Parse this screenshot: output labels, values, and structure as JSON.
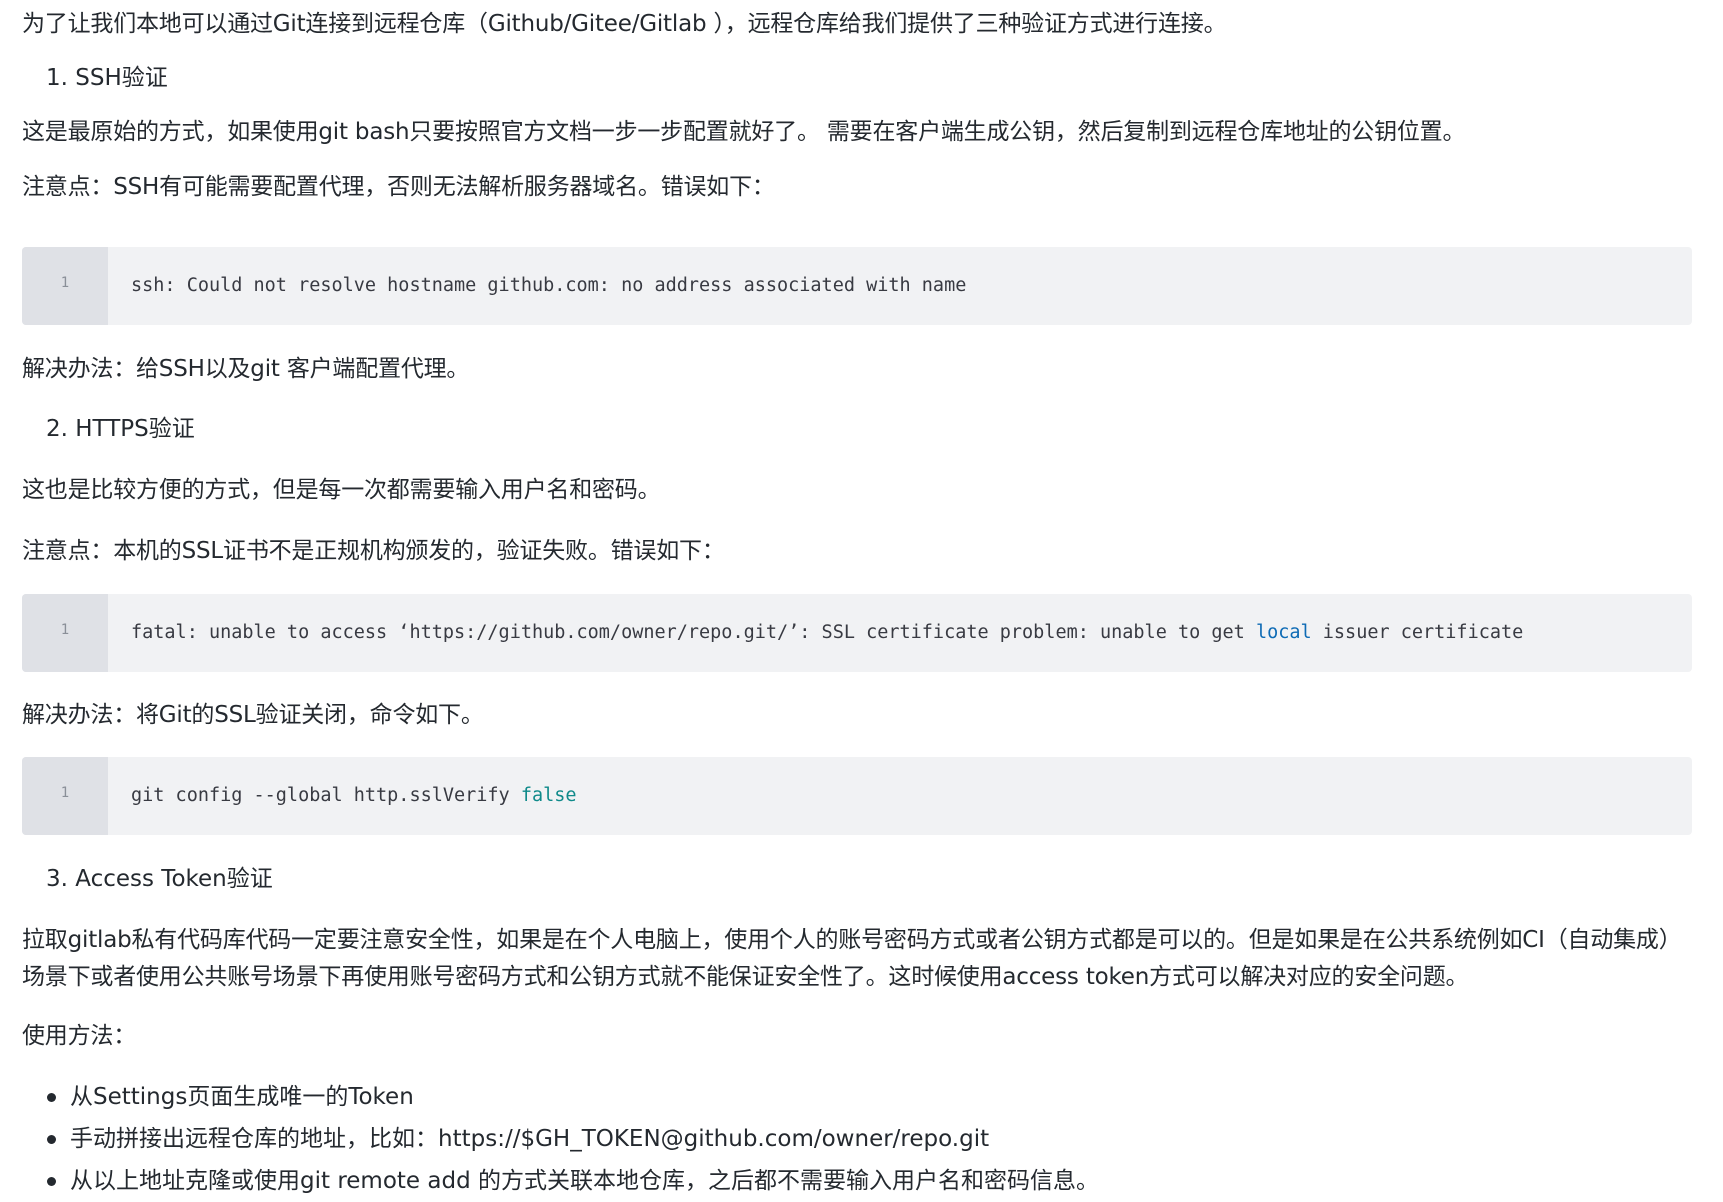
{
  "intro": "为了让我们本地可以通过Git连接到远程仓库（Github/Gitee/Gitlab ），远程仓库给我们提供了三种验证方式进行连接。",
  "sections": {
    "ssh": {
      "heading": "1. SSH验证",
      "desc": "这是最原始的方式，如果使用git bash只要按照官方文档一步一步配置就好了。 需要在客户端生成公钥，然后复制到远程仓库地址的公钥位置。",
      "note": "注意点：SSH有可能需要配置代理，否则无法解析服务器域名。错误如下：",
      "code": {
        "line_no": "1",
        "text": "ssh: Could not resolve hostname github.com: no address associated with name"
      },
      "solution": "解决办法：给SSH以及git 客户端配置代理。"
    },
    "https": {
      "heading": "2. HTTPS验证",
      "desc": "这也是比较方便的方式，但是每一次都需要输入用户名和密码。",
      "note": "注意点：本机的SSL证书不是正规机构颁发的，验证失败。错误如下：",
      "code": {
        "line_no": "1",
        "before": "fatal: unable to access ‘https://github.com/owner/repo.git/’: SSL certificate problem: unable to get ",
        "keyword": "local",
        "after": " issuer certificate"
      },
      "solution": "解决办法：将Git的SSL验证关闭，命令如下。",
      "code2": {
        "line_no": "1",
        "before": "git config --global http.sslVerify ",
        "keyword": "false"
      }
    },
    "token": {
      "heading": "3. Access Token验证",
      "desc": "拉取gitlab私有代码库代码一定要注意安全性，如果是在个人电脑上，使用个人的账号密码方式或者公钥方式都是可以的。但是如果是在公共系统例如CI（自动集成）场景下或者使用公共账号场景下再使用账号密码方式和公钥方式就不能保证安全性了。这时候使用access token方式可以解决对应的安全问题。",
      "usage_label": "使用方法：",
      "steps": [
        "从Settings页面生成唯一的Token",
        "手动拼接出远程仓库的地址，比如：https://$GH_TOKEN@github.com/owner/repo.git",
        "从以上地址克隆或使用git remote add 的方式关联本地仓库，之后都不需要输入用户名和密码信息。"
      ]
    }
  },
  "colors": {
    "text": "#24292f",
    "code_bg": "#f1f2f4",
    "gutter_bg": "#dfe1e6",
    "keyword_blue": "#0e6bb5",
    "keyword_teal": "#0f8a8a"
  }
}
